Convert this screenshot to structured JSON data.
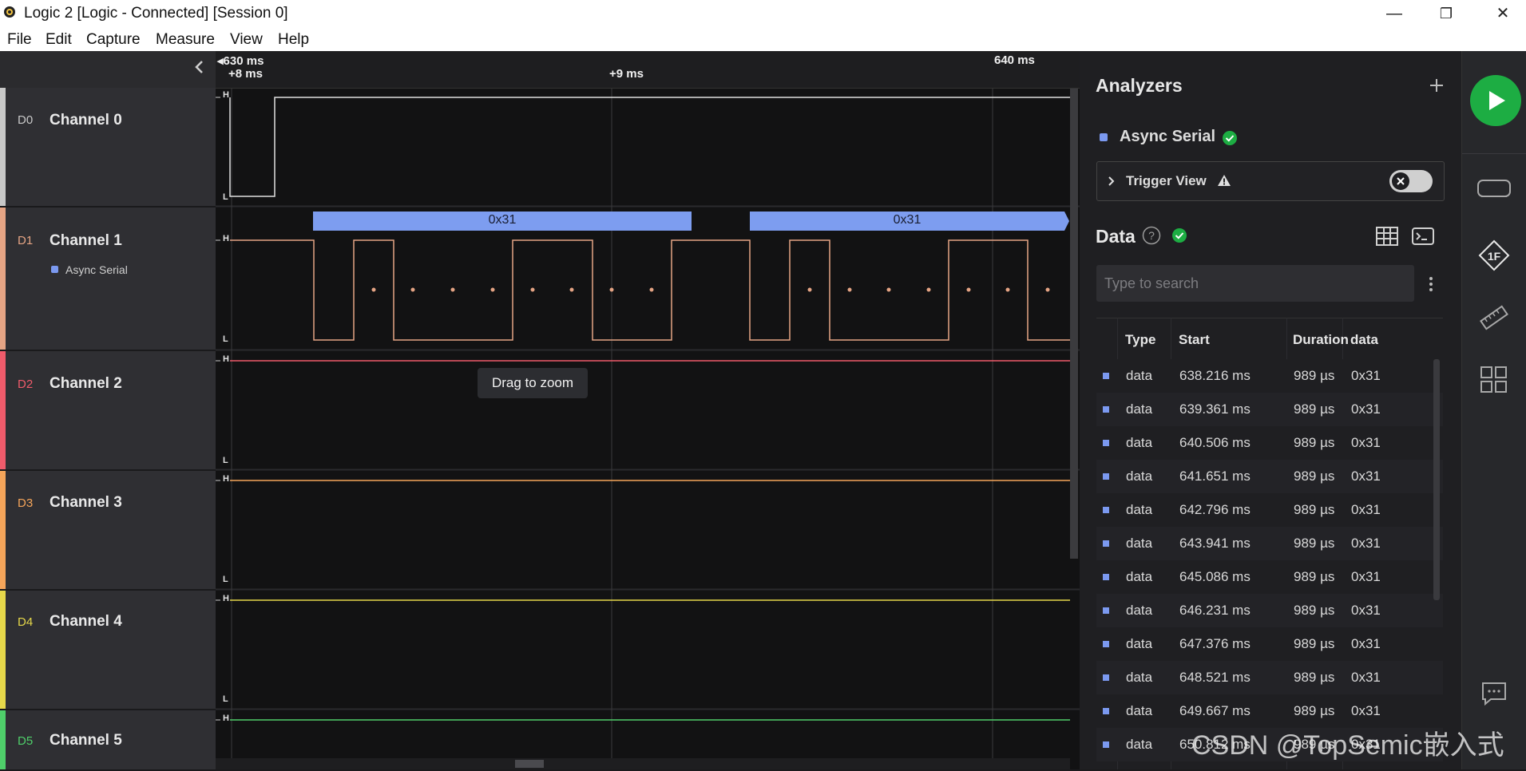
{
  "window": {
    "title": "Logic 2 [Logic - Connected] [Session 0]",
    "minimize": "—",
    "restore": "❐",
    "close": "✕"
  },
  "menu": [
    "File",
    "Edit",
    "Capture",
    "Measure",
    "View",
    "Help"
  ],
  "channels": [
    {
      "id": "D0",
      "name": "Channel 0",
      "color": "#c8c8c8"
    },
    {
      "id": "D1",
      "name": "Channel 1",
      "color": "#e5a484",
      "analyzer": "Async Serial"
    },
    {
      "id": "D2",
      "name": "Channel 2",
      "color": "#f05b6b"
    },
    {
      "id": "D3",
      "name": "Channel 3",
      "color": "#f5a55a"
    },
    {
      "id": "D4",
      "name": "Channel 4",
      "color": "#e6d84a"
    },
    {
      "id": "D5",
      "name": "Channel 5",
      "color": "#4fcf6a"
    }
  ],
  "ruler": {
    "start": "630 ms",
    "start_offset": "+8 ms",
    "mid": "+9 ms",
    "end": "640 ms"
  },
  "levels": {
    "high": "H",
    "low": "L"
  },
  "decoded": [
    "0x31",
    "0x31"
  ],
  "tooltip": "Drag to zoom",
  "analyzers": {
    "title": "Analyzers",
    "add_icon": "plus-icon",
    "item": "Async Serial",
    "item_color": "#7b99f0",
    "status_color": "#1dad43",
    "trigger_label": "Trigger View",
    "trigger_enabled": false
  },
  "data_panel": {
    "title": "Data",
    "search_placeholder": "Type to search",
    "columns": [
      "Type",
      "Start",
      "Duration",
      "data"
    ],
    "rows": [
      {
        "type": "data",
        "start": "638.216 ms",
        "duration": "989 µs",
        "data": "0x31"
      },
      {
        "type": "data",
        "start": "639.361 ms",
        "duration": "989 µs",
        "data": "0x31"
      },
      {
        "type": "data",
        "start": "640.506 ms",
        "duration": "989 µs",
        "data": "0x31"
      },
      {
        "type": "data",
        "start": "641.651 ms",
        "duration": "989 µs",
        "data": "0x31"
      },
      {
        "type": "data",
        "start": "642.796 ms",
        "duration": "989 µs",
        "data": "0x31"
      },
      {
        "type": "data",
        "start": "643.941 ms",
        "duration": "989 µs",
        "data": "0x31"
      },
      {
        "type": "data",
        "start": "645.086 ms",
        "duration": "989 µs",
        "data": "0x31"
      },
      {
        "type": "data",
        "start": "646.231 ms",
        "duration": "989 µs",
        "data": "0x31"
      },
      {
        "type": "data",
        "start": "647.376 ms",
        "duration": "989 µs",
        "data": "0x31"
      },
      {
        "type": "data",
        "start": "648.521 ms",
        "duration": "989 µs",
        "data": "0x31"
      },
      {
        "type": "data",
        "start": "649.667 ms",
        "duration": "989 µs",
        "data": "0x31"
      },
      {
        "type": "data",
        "start": "650.812 ms",
        "duration": "989 µs",
        "data": "0x31"
      }
    ]
  },
  "sidebar_icons": [
    "play-icon",
    "device-icon",
    "analyzer-1f-icon",
    "measure-ruler-icon",
    "extensions-icon",
    "feedback-icon"
  ],
  "watermark": "CSDN @TopSemic嵌入式"
}
